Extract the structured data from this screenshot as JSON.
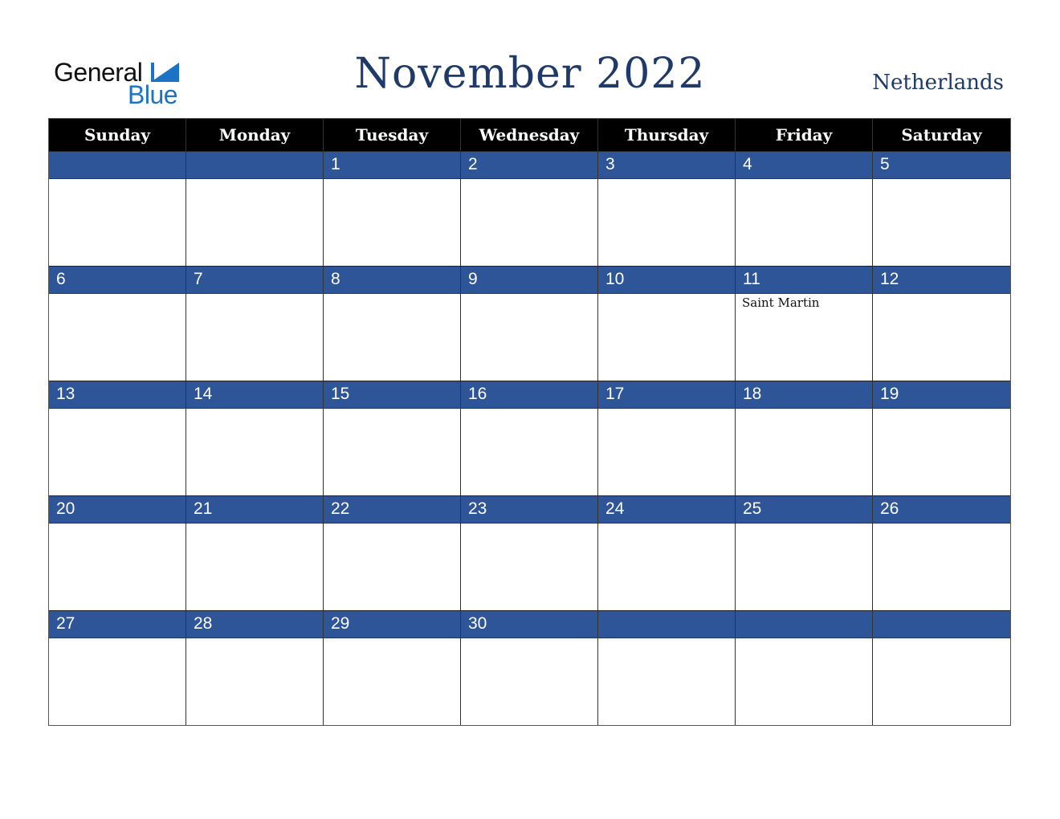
{
  "logo": {
    "word1": "General",
    "word2": "Blue",
    "icon": "triangle-flag-icon"
  },
  "header": {
    "title": "November 2022",
    "country": "Netherlands"
  },
  "colors": {
    "title": "#1f3a68",
    "band": "#2e5597",
    "header_bg": "#000000",
    "logo_blue": "#1a73c4"
  },
  "days": [
    "Sunday",
    "Monday",
    "Tuesday",
    "Wednesday",
    "Thursday",
    "Friday",
    "Saturday"
  ],
  "weeks": [
    [
      {
        "d": "",
        "e": ""
      },
      {
        "d": "",
        "e": ""
      },
      {
        "d": "1",
        "e": ""
      },
      {
        "d": "2",
        "e": ""
      },
      {
        "d": "3",
        "e": ""
      },
      {
        "d": "4",
        "e": ""
      },
      {
        "d": "5",
        "e": ""
      }
    ],
    [
      {
        "d": "6",
        "e": ""
      },
      {
        "d": "7",
        "e": ""
      },
      {
        "d": "8",
        "e": ""
      },
      {
        "d": "9",
        "e": ""
      },
      {
        "d": "10",
        "e": ""
      },
      {
        "d": "11",
        "e": "Saint Martin"
      },
      {
        "d": "12",
        "e": ""
      }
    ],
    [
      {
        "d": "13",
        "e": ""
      },
      {
        "d": "14",
        "e": ""
      },
      {
        "d": "15",
        "e": ""
      },
      {
        "d": "16",
        "e": ""
      },
      {
        "d": "17",
        "e": ""
      },
      {
        "d": "18",
        "e": ""
      },
      {
        "d": "19",
        "e": ""
      }
    ],
    [
      {
        "d": "20",
        "e": ""
      },
      {
        "d": "21",
        "e": ""
      },
      {
        "d": "22",
        "e": ""
      },
      {
        "d": "23",
        "e": ""
      },
      {
        "d": "24",
        "e": ""
      },
      {
        "d": "25",
        "e": ""
      },
      {
        "d": "26",
        "e": ""
      }
    ],
    [
      {
        "d": "27",
        "e": ""
      },
      {
        "d": "28",
        "e": ""
      },
      {
        "d": "29",
        "e": ""
      },
      {
        "d": "30",
        "e": ""
      },
      {
        "d": "",
        "e": ""
      },
      {
        "d": "",
        "e": ""
      },
      {
        "d": "",
        "e": ""
      }
    ]
  ]
}
